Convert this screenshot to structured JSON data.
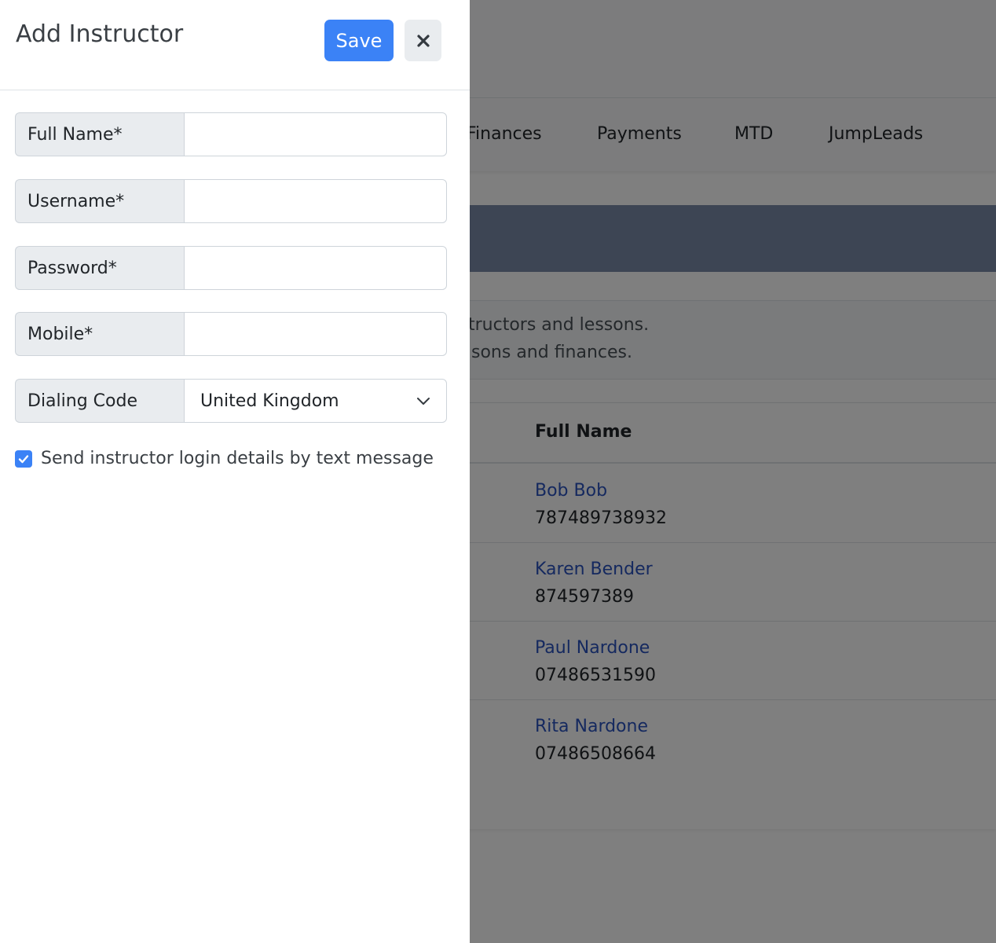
{
  "background": {
    "nav_items": [
      "Finances",
      "Payments",
      "MTD",
      "JumpLeads"
    ],
    "info_lines": [
      "tructors and lessons.",
      "sons and finances."
    ],
    "table": {
      "header": "Full Name",
      "rows": [
        {
          "name": "Bob Bob",
          "phone": "787489738932"
        },
        {
          "name": "Karen Bender",
          "phone": "874597389"
        },
        {
          "name": "Paul Nardone",
          "phone": "07486531590"
        },
        {
          "name": "Rita Nardone",
          "phone": "07486508664"
        }
      ]
    }
  },
  "panel": {
    "title": "Add Instructor",
    "save_label": "Save",
    "close_icon": "close-icon",
    "fields": [
      {
        "label": "Full Name*",
        "value": ""
      },
      {
        "label": "Username*",
        "value": ""
      },
      {
        "label": "Password*",
        "value": ""
      },
      {
        "label": "Mobile*",
        "value": ""
      }
    ],
    "dialing_code": {
      "label": "Dialing Code",
      "value": "United Kingdom"
    },
    "sms_checkbox": {
      "label": "Send instructor login details by text message",
      "checked": true
    }
  },
  "colors": {
    "primary": "#3b82f6",
    "link": "#2a52be",
    "banner": "#0a1f44"
  }
}
